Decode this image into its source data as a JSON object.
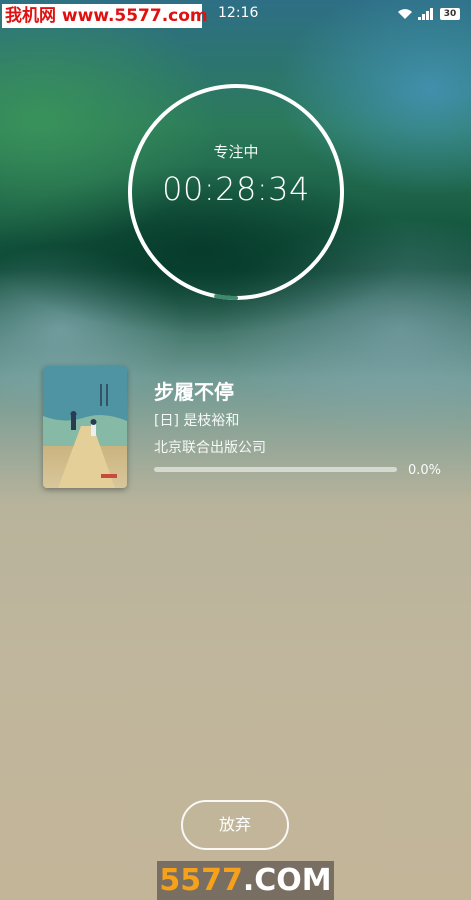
{
  "status_bar": {
    "time": "12:16",
    "battery": "30"
  },
  "watermark": {
    "top_text": "我机网 www.5577.com",
    "bottom_number": "5577",
    "bottom_suffix": ".COM"
  },
  "timer": {
    "label": "专注中",
    "time": "00:28:34",
    "ring_progress": 0.03
  },
  "book": {
    "title": "步履不停",
    "author": "[日] 是枝裕和",
    "publisher": "北京联合出版公司",
    "progress_text": "0.0%",
    "progress": 0.0
  },
  "abandon_label": "放弃",
  "icons": [
    "wifi-icon",
    "signal-icon",
    "battery-icon",
    "book-cover"
  ]
}
